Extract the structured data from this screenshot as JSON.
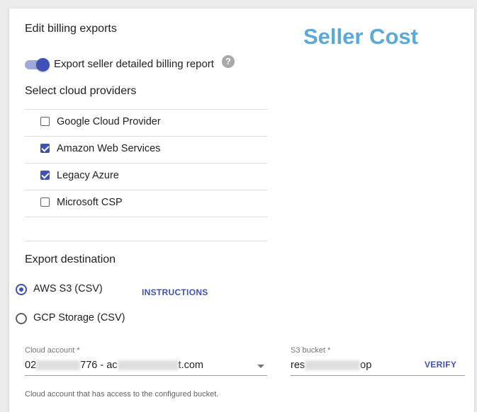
{
  "panel": {
    "title": "Edit billing exports",
    "watermark": "Seller Cost"
  },
  "toggle": {
    "label": "Export seller detailed billing report",
    "on": true,
    "help_glyph": "?"
  },
  "providers": {
    "heading": "Select cloud providers",
    "items": [
      {
        "label": "Google Cloud Provider",
        "checked": false
      },
      {
        "label": "Amazon Web Services",
        "checked": true
      },
      {
        "label": "Legacy Azure",
        "checked": true
      },
      {
        "label": "Microsoft CSP",
        "checked": false
      }
    ]
  },
  "destination": {
    "heading": "Export destination",
    "options": [
      {
        "label": "AWS S3 (CSV)",
        "selected": true
      },
      {
        "label": "GCP Storage (CSV)",
        "selected": false
      }
    ],
    "instructions_label": "INSTRUCTIONS"
  },
  "cloud_account": {
    "label": "Cloud account *",
    "value_start": "02",
    "value_mid": "776 - ac",
    "value_end": "t.com",
    "helper": "Cloud account that has access to the configured bucket."
  },
  "s3_bucket": {
    "label": "S3 bucket *",
    "value_start": "res",
    "value_end": "op",
    "verify_label": "VERIFY"
  },
  "colors": {
    "accent": "#3f51b5",
    "watermark": "#5aa9d6"
  },
  "icons": [
    "question-help-icon",
    "dropdown-caret-icon"
  ]
}
